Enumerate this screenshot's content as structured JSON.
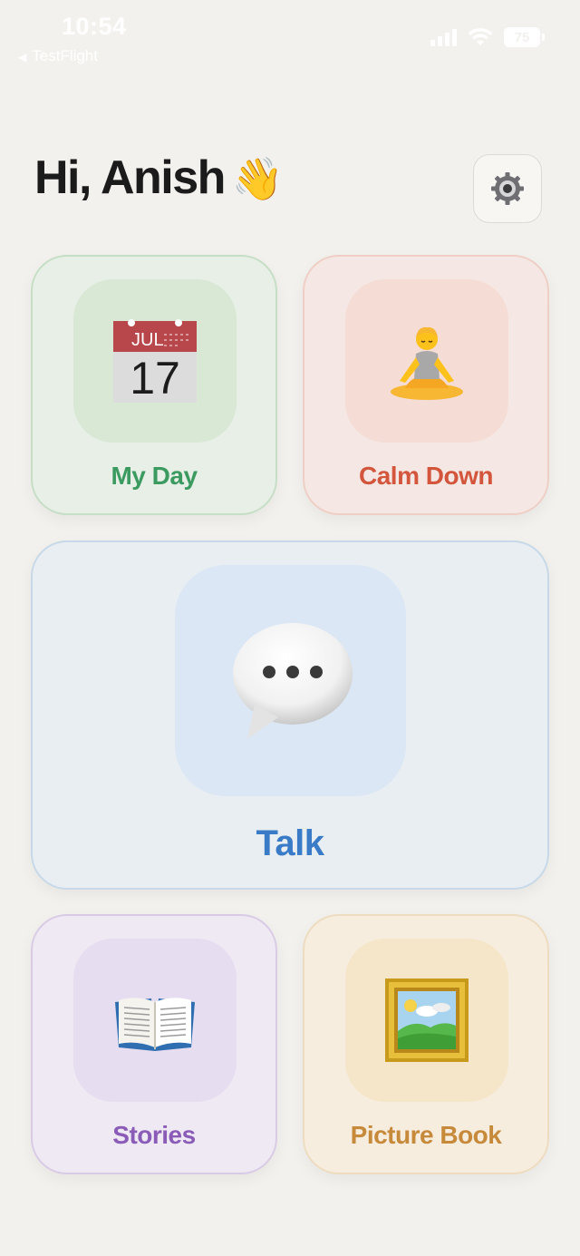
{
  "status_bar": {
    "time": "10:54",
    "back_app": "TestFlight",
    "battery": "75"
  },
  "header": {
    "greeting": "Hi, Anish",
    "wave_emoji": "👋",
    "settings_icon": "gear-icon"
  },
  "cards": {
    "my_day": {
      "label": "My Day",
      "icon": "calendar-icon",
      "calendar_month": "JUL",
      "calendar_day": "17",
      "color": "#3b9a5f"
    },
    "calm_down": {
      "label": "Calm Down",
      "icon": "meditation-icon",
      "emoji": "🧘",
      "color": "#d2553c"
    },
    "talk": {
      "label": "Talk",
      "icon": "speech-bubble-icon",
      "color": "#3a7bc8"
    },
    "stories": {
      "label": "Stories",
      "icon": "open-book-icon",
      "emoji": "📖",
      "color": "#8a5cb8"
    },
    "picture_book": {
      "label": "Picture Book",
      "icon": "framed-picture-icon",
      "emoji": "🖼️",
      "color": "#c7893a"
    }
  }
}
